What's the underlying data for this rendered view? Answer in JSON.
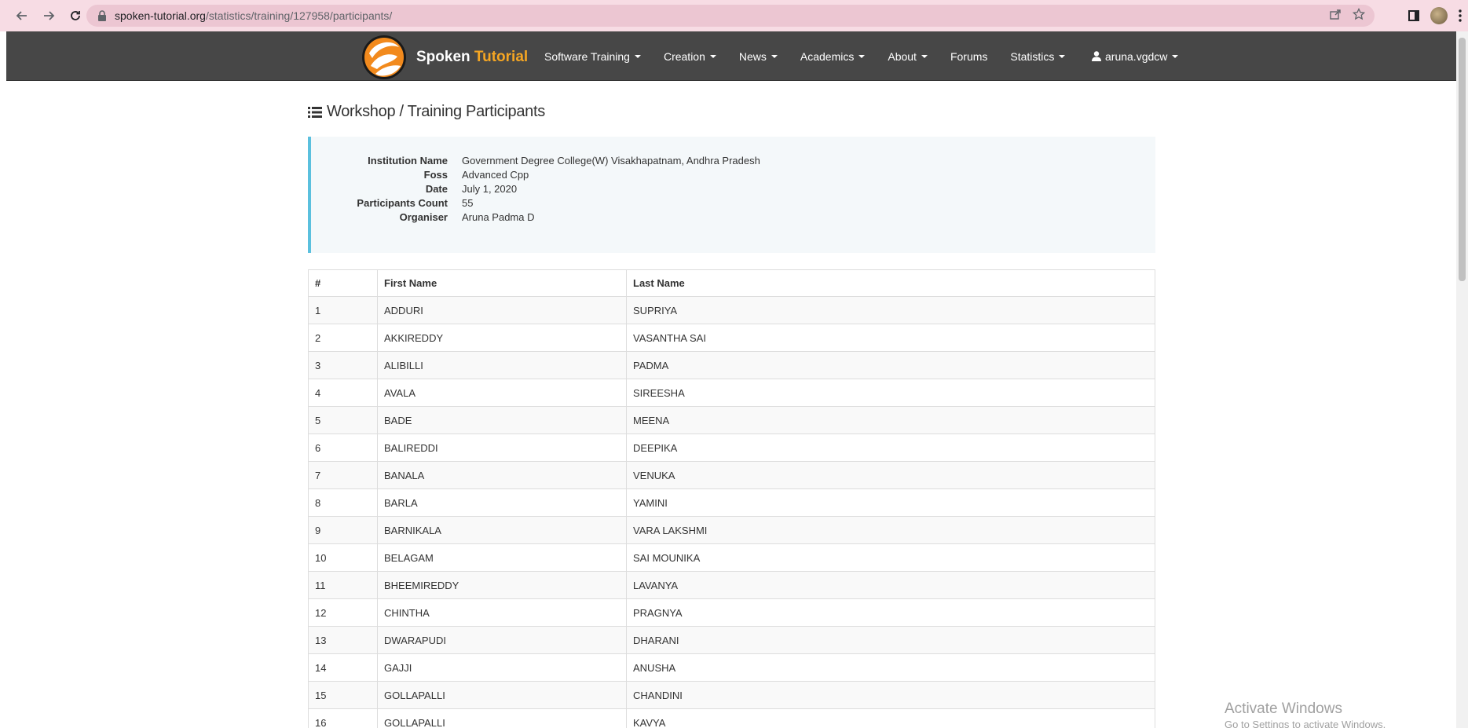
{
  "browser": {
    "url_host": "spoken-tutorial.org",
    "url_path": "/statistics/training/127958/participants/"
  },
  "site": {
    "brand_primary": "Spoken",
    "brand_accent": "Tutorial",
    "accent_color": "#f5a623",
    "nav": [
      {
        "label": "Software Training",
        "dropdown": true
      },
      {
        "label": "Creation",
        "dropdown": true
      },
      {
        "label": "News",
        "dropdown": true
      },
      {
        "label": "Academics",
        "dropdown": true
      },
      {
        "label": "About",
        "dropdown": true
      },
      {
        "label": "Forums",
        "dropdown": false
      },
      {
        "label": "Statistics",
        "dropdown": true
      }
    ],
    "user": "aruna.vgdcw"
  },
  "page": {
    "title": "Workshop / Training Participants",
    "info": [
      {
        "label": "Institution Name",
        "value": "Government Degree College(W) Visakhapatnam, Andhra Pradesh"
      },
      {
        "label": "Foss",
        "value": "Advanced Cpp"
      },
      {
        "label": "Date",
        "value": "July 1, 2020"
      },
      {
        "label": "Participants Count",
        "value": "55"
      },
      {
        "label": "Organiser",
        "value": "Aruna Padma D"
      }
    ],
    "table": {
      "headers": [
        "#",
        "First Name",
        "Last Name"
      ],
      "rows": [
        [
          "1",
          "ADDURI",
          "SUPRIYA"
        ],
        [
          "2",
          "AKKIREDDY",
          "VASANTHA SAI"
        ],
        [
          "3",
          "ALIBILLI",
          "PADMA"
        ],
        [
          "4",
          "AVALA",
          "SIREESHA"
        ],
        [
          "5",
          "BADE",
          "MEENA"
        ],
        [
          "6",
          "BALIREDDI",
          "DEEPIKA"
        ],
        [
          "7",
          "BANALA",
          "VENUKA"
        ],
        [
          "8",
          "BARLA",
          "YAMINI"
        ],
        [
          "9",
          "BARNIKALA",
          "VARA LAKSHMI"
        ],
        [
          "10",
          "BELAGAM",
          "SAI MOUNIKA"
        ],
        [
          "11",
          "BHEEMIREDDY",
          "LAVANYA"
        ],
        [
          "12",
          "CHINTHA",
          "PRAGNYA"
        ],
        [
          "13",
          "DWARAPUDI",
          "DHARANI"
        ],
        [
          "14",
          "GAJJI",
          "ANUSHA"
        ],
        [
          "15",
          "GOLLAPALLI",
          "CHANDINI"
        ],
        [
          "16",
          "GOLLAPALLI",
          "KAVYA"
        ]
      ]
    }
  },
  "watermark": {
    "line1": "Activate Windows",
    "line2": "Go to Settings to activate Windows."
  }
}
